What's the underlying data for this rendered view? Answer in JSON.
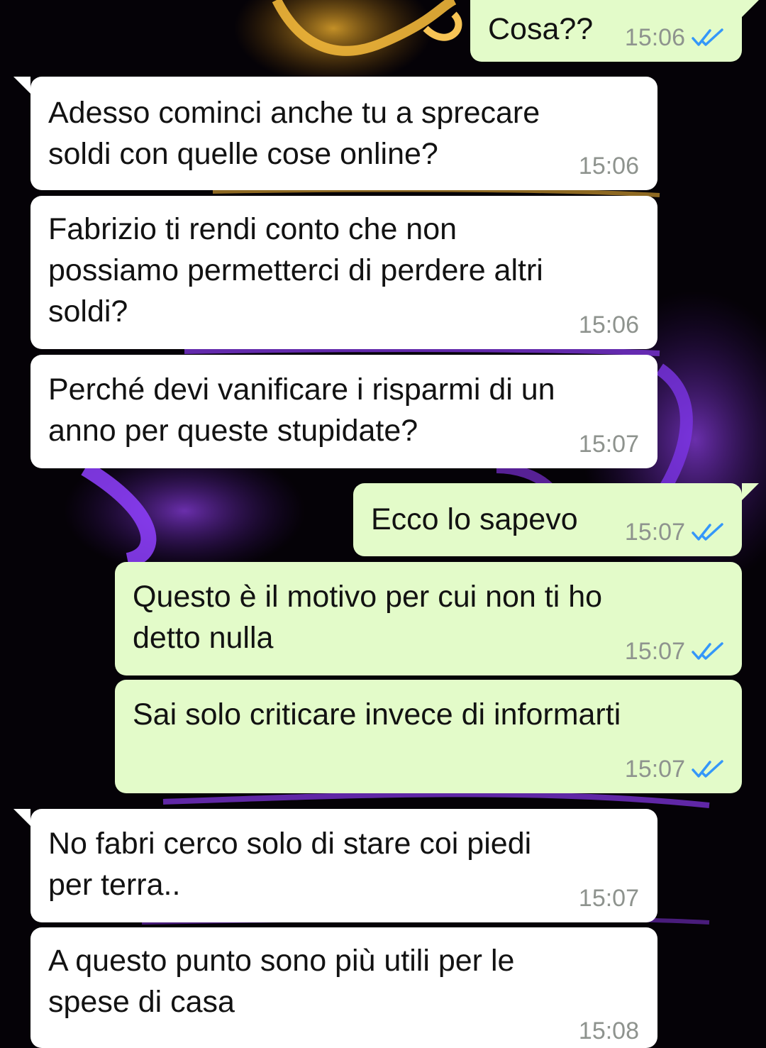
{
  "chat": {
    "messages": [
      {
        "direction": "outgoing",
        "text": "Cosa??",
        "time": "15:06",
        "status_icon": "double-check-icon"
      },
      {
        "direction": "incoming",
        "text": "Adesso cominci anche tu a sprecare\nsoldi con quelle cose online?",
        "time": "15:06"
      },
      {
        "direction": "incoming",
        "text": "Fabrizio ti rendi conto che non\npossiamo permetterci di perdere altri\nsoldi?",
        "time": "15:06"
      },
      {
        "direction": "incoming",
        "text": "Perché devi vanificare i risparmi di un\nanno per queste stupidate?",
        "time": "15:07"
      },
      {
        "direction": "outgoing",
        "text": "Ecco lo sapevo",
        "time": "15:07",
        "status_icon": "double-check-icon"
      },
      {
        "direction": "outgoing",
        "text": "Questo è il motivo per cui non ti ho\ndetto nulla",
        "time": "15:07",
        "status_icon": "double-check-icon"
      },
      {
        "direction": "outgoing",
        "text": "Sai solo criticare invece di informarti",
        "time": "15:07",
        "status_icon": "double-check-icon"
      },
      {
        "direction": "incoming",
        "text": "No fabri cerco solo di stare coi piedi\nper terra..",
        "time": "15:07"
      },
      {
        "direction": "incoming",
        "text": "A questo punto sono più utili per le\nspese di casa",
        "time": "15:08"
      }
    ]
  },
  "colors": {
    "incoming_bubble": "#ffffff",
    "outgoing_bubble": "#e3fbc9",
    "read_tick": "#3497f9",
    "timestamp": "#8e938e",
    "wallpaper_base": "#050207",
    "wallpaper_accent": "#6a2bb8"
  }
}
